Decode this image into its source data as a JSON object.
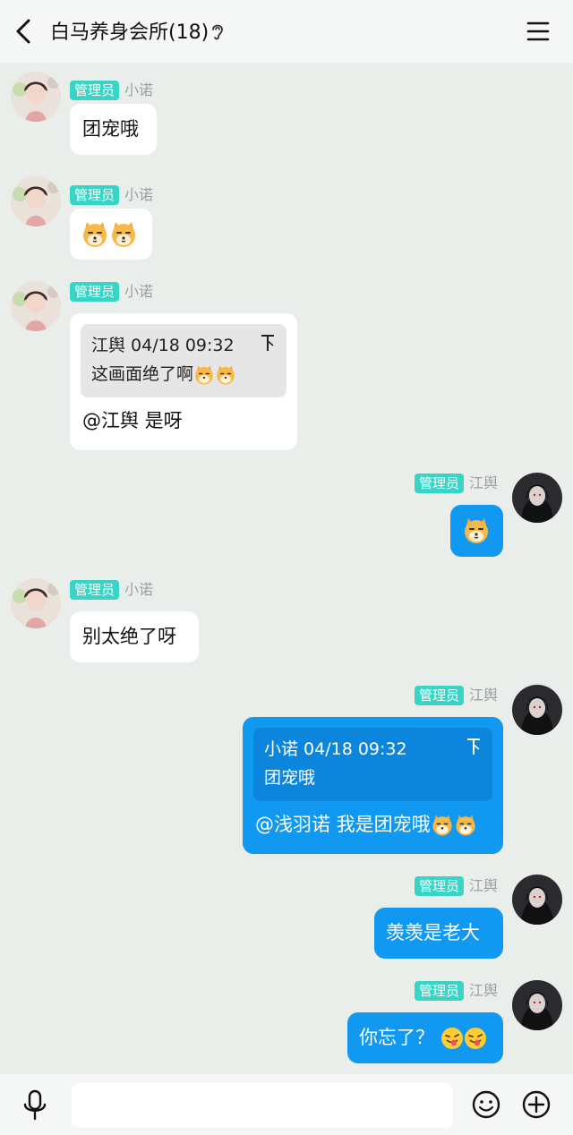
{
  "header": {
    "title": "白马养身会所(18)"
  },
  "messages": [
    {
      "side": "left",
      "role_badge": "管理员",
      "sender": "小诺",
      "text": "团宠哦"
    },
    {
      "side": "left",
      "role_badge": "管理员",
      "sender": "小诺",
      "emojis": [
        "doge-tiger-emoji",
        "doge-tiger-emoji"
      ]
    },
    {
      "side": "left",
      "role_badge": "管理员",
      "sender": "小诺",
      "quote": {
        "header": "江舆 04/18 09:32",
        "text": "这画面绝了啊"
      },
      "text": "@江舆 是呀"
    },
    {
      "side": "right",
      "role_badge": "管理员",
      "sender": "江舆",
      "emojis": [
        "doge-tiger-emoji"
      ]
    },
    {
      "side": "left",
      "role_badge": "管理员",
      "sender": "小诺",
      "text": "别太绝了呀"
    },
    {
      "side": "right",
      "role_badge": "管理员",
      "sender": "江舆",
      "quote": {
        "header": "小诺 04/18 09:32",
        "text": "团宠哦"
      },
      "text": "@浅羽诺 我是团宠哦"
    },
    {
      "side": "right",
      "role_badge": "管理员",
      "sender": "江舆",
      "text": "羡羡是老大"
    },
    {
      "side": "right",
      "role_badge": "管理员",
      "sender": "江舆",
      "text": "你忘了？"
    }
  ],
  "colors": {
    "background": "#eaeeea",
    "badge": "#38d4c6",
    "right_bubble": "#1198f0",
    "left_bubble": "#ffffff"
  },
  "icons": [
    "back-arrow-icon",
    "ear-icon",
    "menu-icon",
    "microphone-icon",
    "smiley-icon",
    "plus-icon",
    "pin-icon"
  ]
}
